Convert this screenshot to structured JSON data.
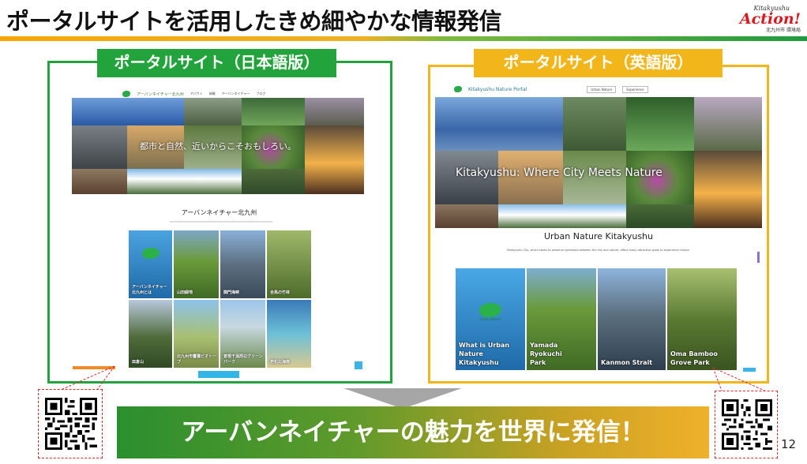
{
  "slide": {
    "title": "ポータルサイトを活用したきめ細やかな情報発信",
    "page_number": "12",
    "banner_text": "アーバンネイチャーの魅力を世界に発信！"
  },
  "logo": {
    "small_text": "Kitakyushu",
    "main_text": "Action!",
    "sub_text": "北九州市 環境局"
  },
  "panels": {
    "jp_label": "ポータルサイト（日本語版）",
    "en_label": "ポータルサイト（英語版）"
  },
  "jp_site": {
    "site_name": "アーバンネイチャー北九州",
    "nav_items": [
      "アバウト",
      "体験",
      "アーバンネイチャー",
      "ブログ"
    ],
    "hero_tagline": "都市と自然、近いからこそおもしろい。",
    "section_title": "アーバンネイチャー北九州",
    "cards": [
      "アーバンネイチャー北九州とは",
      "山田緑地",
      "関門海峡",
      "合馬の竹林",
      "皿倉山",
      "北九州市響灘ビオトープ",
      "曽根干潟周辺グリーンパーク",
      "若松北海岸"
    ]
  },
  "en_site": {
    "site_name": "Kitakyushu Nature Portal",
    "nav_items": [
      "Urban Nature",
      "Experience"
    ],
    "hero_tagline": "Kitakyushu: Where City Meets Nature",
    "section_title": "Urban Nature Kitakyushu",
    "section_desc": "Kitakyushu City, which seeks to preserve symbiosis between the city and nature, offers many attractive spots to experience nature.",
    "emblem_text": "Urban Nature",
    "cards": [
      "What is Urban Nature Kitakyushu",
      "Yamada Ryokuchi Park",
      "Kanmon Strait",
      "Oma Bamboo Grove Park"
    ]
  },
  "colors": {
    "jp_accent": "#22a33c",
    "en_accent": "#f2b51a",
    "leader_line": "#d62a2a"
  }
}
